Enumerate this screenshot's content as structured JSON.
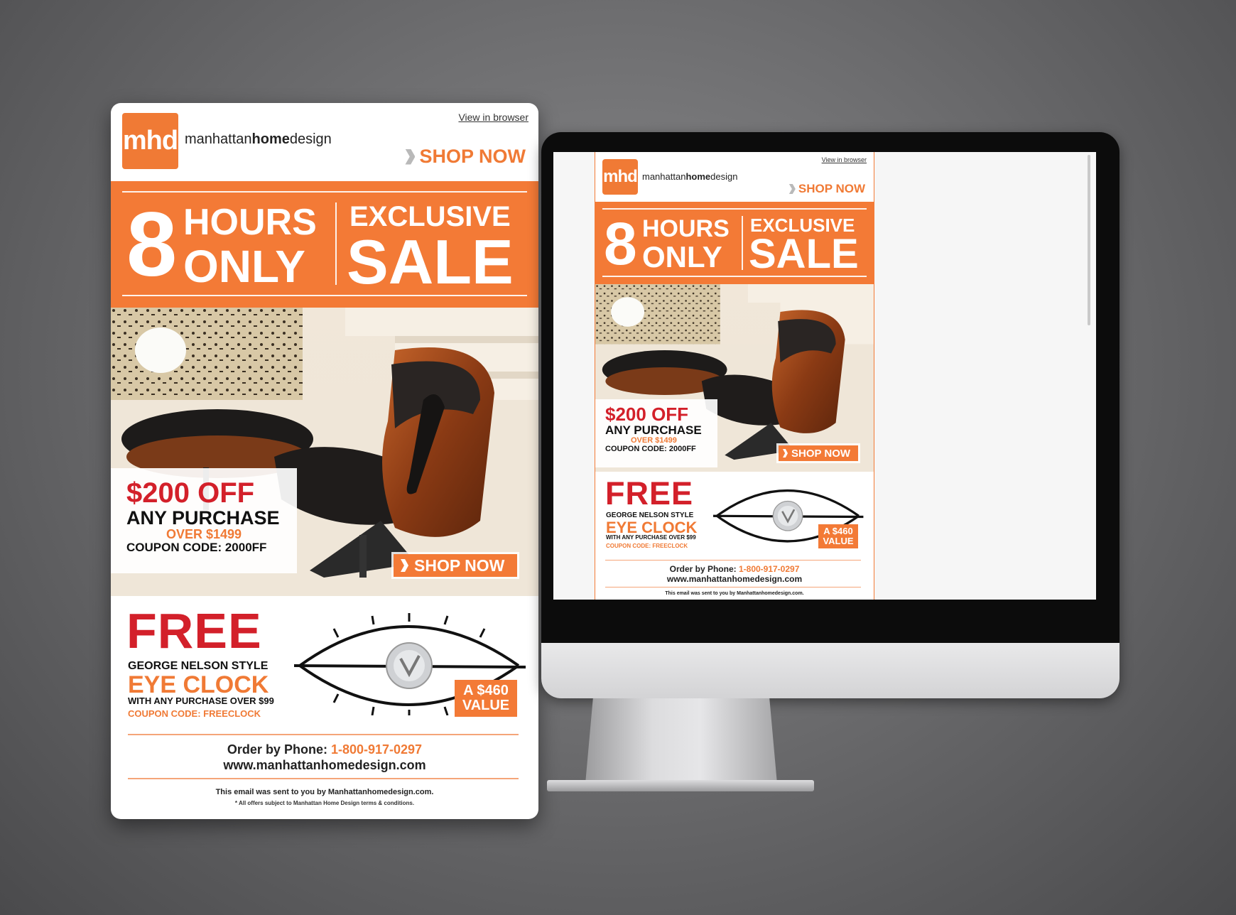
{
  "email": {
    "logo_text": "mhd",
    "brand_light_1": "manhattan",
    "brand_bold": "home",
    "brand_light_2": "design",
    "view_in_browser": "View in  browser",
    "shop_now_top": "SHOP NOW",
    "banner": {
      "number": "8",
      "hours": "HOURS",
      "only": "ONLY",
      "exclusive": "EXCLUSIVE",
      "sale": "SALE"
    },
    "offer": {
      "amount": "$200 OFF",
      "line2": "ANY PURCHASE",
      "line3": "OVER $1499",
      "coupon_label": "COUPON CODE: ",
      "coupon_code": "2000FF"
    },
    "shop_now_button": "SHOP NOW",
    "free": {
      "headline": "FREE",
      "style": "GEORGE NELSON STYLE",
      "product": "EYE CLOCK",
      "condition": "WITH ANY PURCHASE OVER $99",
      "coupon": "COUPON CODE: FREECLOCK",
      "value_line1": "A $460",
      "value_line2": "VALUE"
    },
    "order_label": "Order by Phone: ",
    "phone": "1-800-917-0297",
    "website": "www.manhattanhomedesign.com",
    "footer_sent": "This email was sent to you by Manhattanhomedesign.com.",
    "footer_terms": "* All offers subject to Manhattan Home Design terms & conditions."
  },
  "colors": {
    "brand_orange": "#f37a36",
    "offer_red": "#d3202a",
    "background": "#6e6e70"
  },
  "icons": [
    "chevron-right-icon",
    "lounge-chair-photo",
    "eye-clock-image"
  ]
}
